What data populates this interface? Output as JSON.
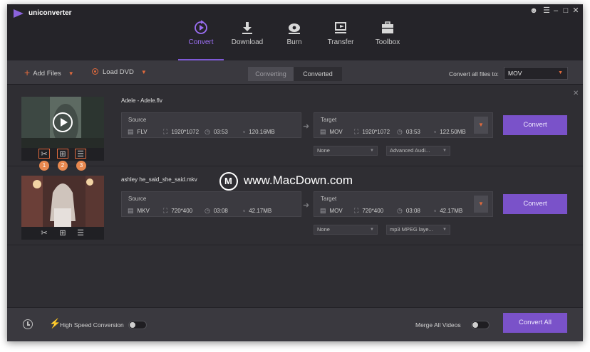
{
  "app": {
    "title": "uniconverter",
    "brand_color": "#7a52c9",
    "accent_color": "#e06a3d"
  },
  "nav": [
    {
      "label": "Convert",
      "icon": "convert-icon"
    },
    {
      "label": "Download",
      "icon": "download-icon"
    },
    {
      "label": "Burn",
      "icon": "burn-icon"
    },
    {
      "label": "Transfer",
      "icon": "transfer-icon"
    },
    {
      "label": "Toolbox",
      "icon": "toolbox-icon"
    }
  ],
  "toolbar": {
    "add_files": "Add Files",
    "load_dvd": "Load DVD",
    "tab_converting": "Converting",
    "tab_converted": "Converted",
    "convert_all_to_label": "Convert all files to:",
    "convert_all_format": "MOV"
  },
  "files": [
    {
      "name": "Adele - Adele.flv",
      "source": {
        "title": "Source",
        "format": "FLV",
        "resolution": "1920*1072",
        "duration": "03:53",
        "size": "120.16MB"
      },
      "target": {
        "title": "Target",
        "format": "MOV",
        "resolution": "1920*1072",
        "duration": "03:53",
        "size": "122.50MB"
      },
      "subtitle": "None",
      "audio": "Advanced Audi...",
      "convert_label": "Convert",
      "badges": [
        "1",
        "2",
        "3"
      ]
    },
    {
      "name": "ashley he_said_she_said.mkv",
      "source": {
        "title": "Source",
        "format": "MKV",
        "resolution": "720*400",
        "duration": "03:08",
        "size": "42.17MB"
      },
      "target": {
        "title": "Target",
        "format": "MOV",
        "resolution": "720*400",
        "duration": "03:08",
        "size": "42.17MB"
      },
      "subtitle": "None",
      "audio": "mp3 MPEG laye...",
      "convert_label": "Convert"
    }
  ],
  "bottom": {
    "high_speed": "High Speed Conversion",
    "merge_all": "Merge All Videos",
    "convert_all": "Convert All"
  },
  "watermark": "www.MacDown.com"
}
